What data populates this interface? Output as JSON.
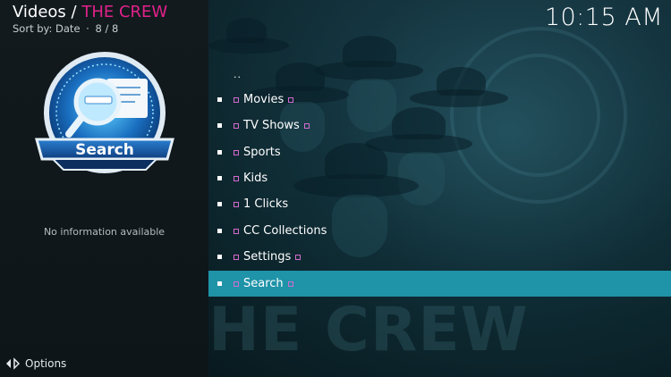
{
  "header": {
    "section": "Videos",
    "separator": "/",
    "addon": "THE CREW",
    "sort_label": "Sort by: Date",
    "sort_sep": "·",
    "position": "8 / 8",
    "clock": "10:15 AM"
  },
  "thumbnail": {
    "label": "Search",
    "icon": "magnifier-document-icon"
  },
  "info": {
    "no_info": "No information available"
  },
  "list": {
    "parent": "..",
    "items": [
      {
        "label": "Movies"
      },
      {
        "label": "TV Shows"
      },
      {
        "label": "Sports"
      },
      {
        "label": "Kids"
      },
      {
        "label": "1 Clicks"
      },
      {
        "label": "CC Collections"
      },
      {
        "label": "Settings"
      },
      {
        "label": "Search"
      }
    ],
    "selected_index": 7
  },
  "fanart": {
    "watermark": "HE CREW"
  },
  "footer": {
    "options_label": "Options"
  },
  "colors": {
    "accent": "#e0228a",
    "selection": "#1f93a8",
    "marker": "#d36bcf"
  }
}
